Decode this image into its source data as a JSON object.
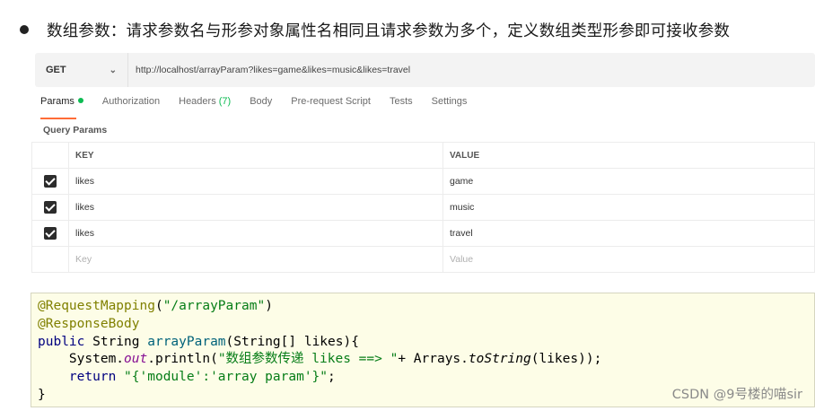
{
  "heading": {
    "text": "数组参数：请求参数名与形参对象属性名相同且请求参数为多个，定义数组类型形参即可接收参数"
  },
  "request": {
    "method": "GET",
    "url": "http://localhost/arrayParam?likes=game&likes=music&likes=travel"
  },
  "tabs": [
    {
      "label": "Params",
      "active": true
    },
    {
      "label": "Authorization"
    },
    {
      "label": "Headers",
      "count": "(7)"
    },
    {
      "label": "Body"
    },
    {
      "label": "Pre-request Script"
    },
    {
      "label": "Tests"
    },
    {
      "label": "Settings"
    }
  ],
  "query_params": {
    "title": "Query Params",
    "headers": {
      "key": "KEY",
      "value": "VALUE"
    },
    "rows": [
      {
        "checked": true,
        "key": "likes",
        "value": "game"
      },
      {
        "checked": true,
        "key": "likes",
        "value": "music"
      },
      {
        "checked": true,
        "key": "likes",
        "value": "travel"
      }
    ],
    "placeholder": {
      "key": "Key",
      "value": "Value"
    }
  },
  "code": {
    "line1_ann": "@RequestMapping",
    "line1_paren_open": "(",
    "line1_str": "\"/arrayParam\"",
    "line1_paren_close": ")",
    "line2_ann": "@ResponseBody",
    "line3_kw": "public",
    "line3_type": " String ",
    "line3_method": "arrayParam",
    "line3_rest": "(String[] likes){",
    "line4_a": "    System.",
    "line4_out": "out",
    "line4_b": ".println(",
    "line4_str": "\"数组参数传递 likes ==> \"",
    "line4_c": "+ Arrays.",
    "line4_tostring": "toString",
    "line4_d": "(likes));",
    "line5_kw": "    return",
    "line5_str": " \"{'module':'array param'}\"",
    "line5_end": ";",
    "line6": "}"
  },
  "watermark": "CSDN @9号楼的喵sir",
  "colors": {
    "accent": "#ff6c37",
    "status_green": "#0cbb52",
    "code_bg": "#fdfde7"
  }
}
